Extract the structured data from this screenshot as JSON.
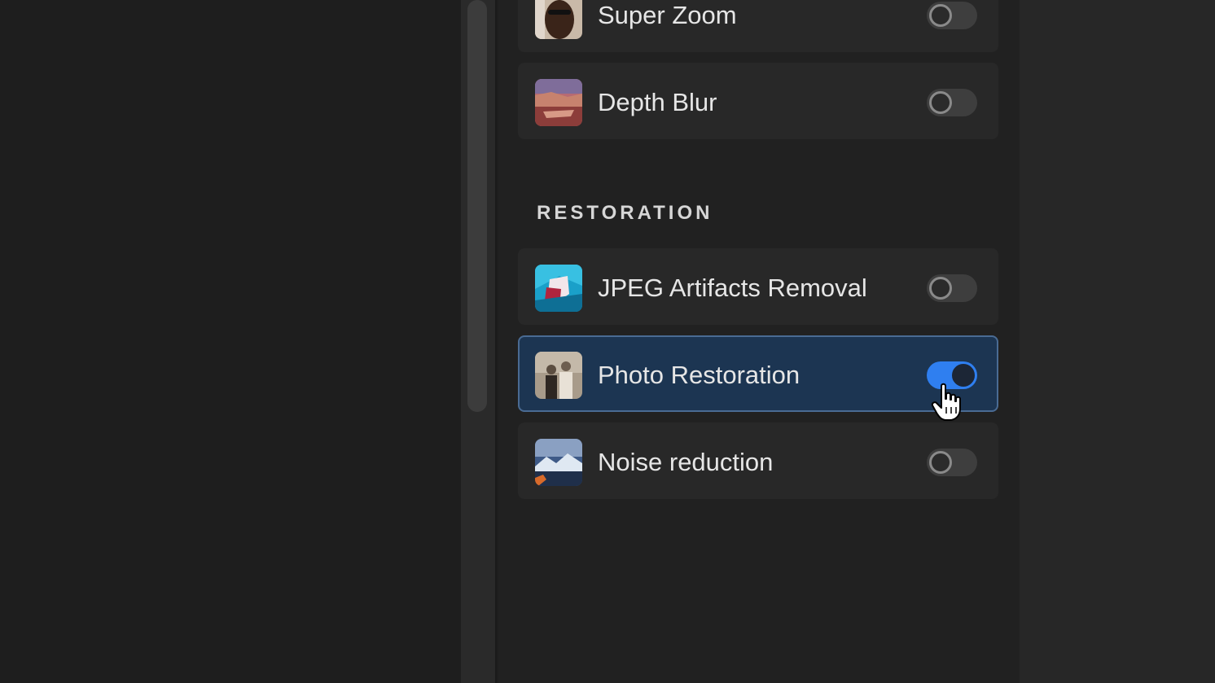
{
  "filters_top": [
    {
      "label": "Super Zoom",
      "icon": "portrait-thumbnail-icon",
      "enabled": false
    },
    {
      "label": "Depth Blur",
      "icon": "canyon-thumbnail-icon",
      "enabled": false
    }
  ],
  "restoration": {
    "header": "RESTORATION",
    "items": [
      {
        "label": "JPEG Artifacts Removal",
        "icon": "artifact-thumbnail-icon",
        "enabled": false
      },
      {
        "label": "Photo Restoration",
        "icon": "old-photo-thumbnail-icon",
        "enabled": true
      },
      {
        "label": "Noise reduction",
        "icon": "mountain-thumbnail-icon",
        "enabled": false
      }
    ]
  },
  "colors": {
    "accent": "#2f7ff0",
    "active_row": "#1c3552",
    "panel": "#212121",
    "row": "#282828"
  }
}
